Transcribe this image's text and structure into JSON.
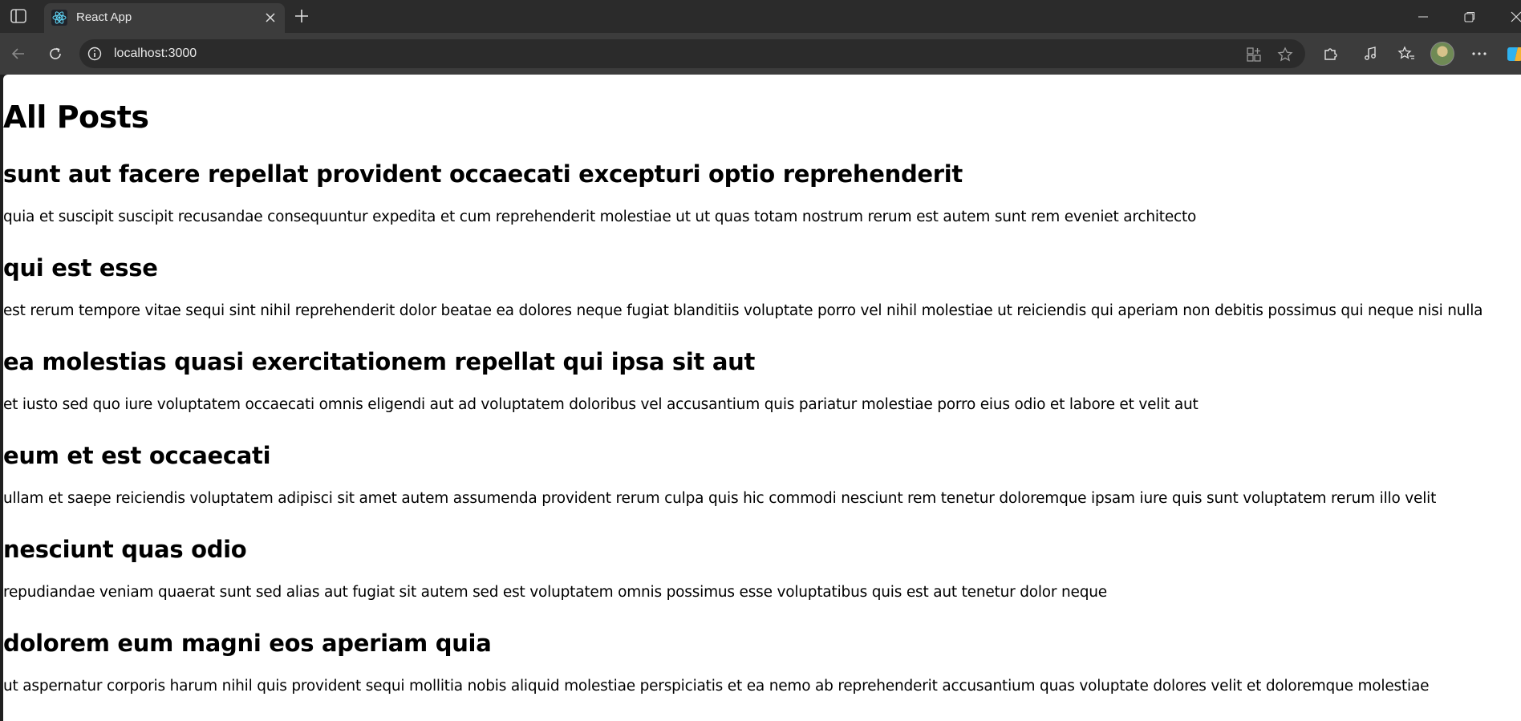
{
  "browser": {
    "tab_title": "React App",
    "url": "localhost:3000",
    "icons": {
      "sidebar": "sidebar-toggle-icon",
      "favicon": "react-logo-icon",
      "tab_close": "close-icon",
      "new_tab": "plus-icon",
      "back": "back-arrow-icon",
      "refresh": "refresh-icon",
      "site_info": "info-icon",
      "app_available": "app-grid-icon",
      "favorite": "star-icon",
      "extensions": "puzzle-icon",
      "media": "music-note-icon",
      "favorites": "favorites-icon",
      "more": "more-dots-icon",
      "copilot": "copilot-icon"
    }
  },
  "page": {
    "title": "All Posts",
    "posts": [
      {
        "title": "sunt aut facere repellat provident occaecati excepturi optio reprehenderit",
        "body": "quia et suscipit suscipit recusandae consequuntur expedita et cum reprehenderit molestiae ut ut quas totam nostrum rerum est autem sunt rem eveniet architecto"
      },
      {
        "title": "qui est esse",
        "body": "est rerum tempore vitae sequi sint nihil reprehenderit dolor beatae ea dolores neque fugiat blanditiis voluptate porro vel nihil molestiae ut reiciendis qui aperiam non debitis possimus qui neque nisi nulla"
      },
      {
        "title": "ea molestias quasi exercitationem repellat qui ipsa sit aut",
        "body": "et iusto sed quo iure voluptatem occaecati omnis eligendi aut ad voluptatem doloribus vel accusantium quis pariatur molestiae porro eius odio et labore et velit aut"
      },
      {
        "title": "eum et est occaecati",
        "body": "ullam et saepe reiciendis voluptatem adipisci sit amet autem assumenda provident rerum culpa quis hic commodi nesciunt rem tenetur doloremque ipsam iure quis sunt voluptatem rerum illo velit"
      },
      {
        "title": "nesciunt quas odio",
        "body": "repudiandae veniam quaerat sunt sed alias aut fugiat sit autem sed est voluptatem omnis possimus esse voluptatibus quis est aut tenetur dolor neque"
      },
      {
        "title": "dolorem eum magni eos aperiam quia",
        "body": "ut aspernatur corporis harum nihil quis provident sequi mollitia nobis aliquid molestiae perspiciatis et ea nemo ab reprehenderit accusantium quas voluptate dolores velit et doloremque molestiae"
      }
    ]
  }
}
